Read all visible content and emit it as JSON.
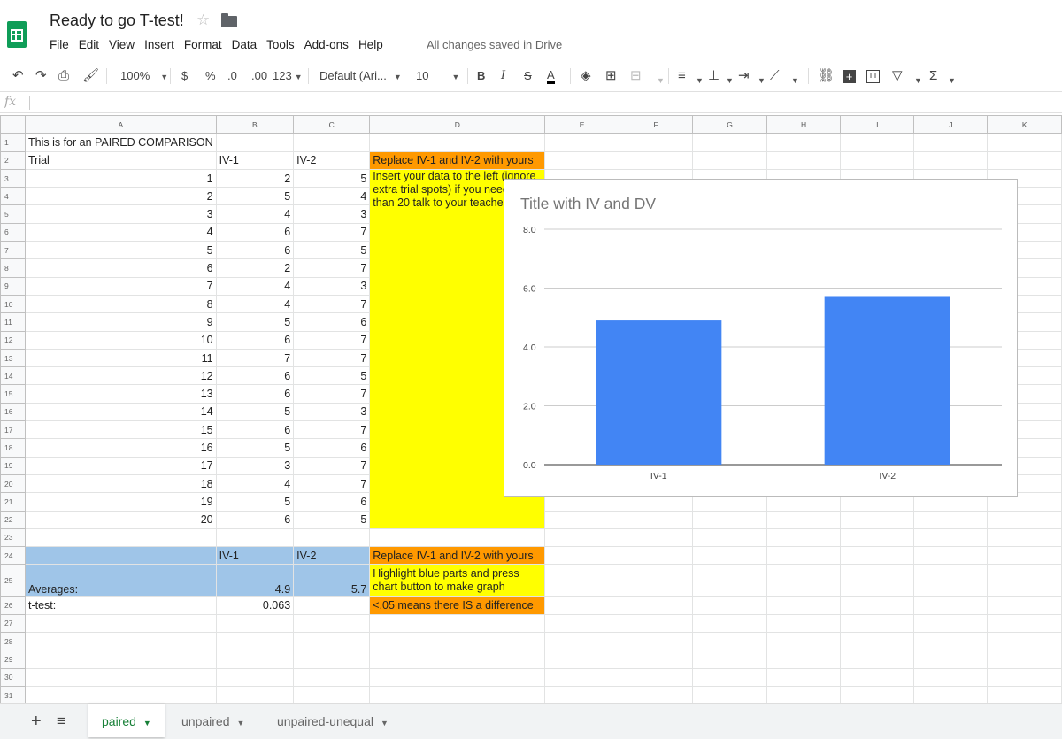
{
  "app": {
    "doc_title": "Ready to go T-test!",
    "save_status": "All changes saved in Drive",
    "menu": [
      "File",
      "Edit",
      "View",
      "Insert",
      "Format",
      "Data",
      "Tools",
      "Add-ons",
      "Help"
    ]
  },
  "toolbar": {
    "zoom": "100%",
    "currency": "$",
    "percent": "%",
    "dec_decrease": ".0",
    "dec_increase": ".00",
    "more_formats": "123",
    "font": "Default (Ari...",
    "font_size": "10",
    "bold": "B",
    "italic": "I",
    "strike": "S",
    "text_color": "A"
  },
  "formula_bar": {
    "fx": "fx",
    "value": ""
  },
  "columns": [
    "A",
    "B",
    "C",
    "D",
    "E",
    "F",
    "G",
    "H",
    "I",
    "J",
    "K"
  ],
  "rows": {
    "r1": {
      "A": "This is for an PAIRED COMPARISON"
    },
    "r2": {
      "A": "Trial",
      "B": "IV-1",
      "C": "IV-2",
      "D": "Replace IV-1 and IV-2 with yours"
    },
    "trials": [
      [
        "1",
        "2",
        "5"
      ],
      [
        "2",
        "5",
        "4"
      ],
      [
        "3",
        "4",
        "3"
      ],
      [
        "4",
        "6",
        "7"
      ],
      [
        "5",
        "6",
        "5"
      ],
      [
        "6",
        "2",
        "7"
      ],
      [
        "7",
        "4",
        "3"
      ],
      [
        "8",
        "4",
        "7"
      ],
      [
        "9",
        "5",
        "6"
      ],
      [
        "10",
        "6",
        "7"
      ],
      [
        "11",
        "7",
        "7"
      ],
      [
        "12",
        "6",
        "5"
      ],
      [
        "13",
        "6",
        "7"
      ],
      [
        "14",
        "5",
        "3"
      ],
      [
        "15",
        "6",
        "7"
      ],
      [
        "16",
        "5",
        "6"
      ],
      [
        "17",
        "3",
        "7"
      ],
      [
        "18",
        "4",
        "7"
      ],
      [
        "19",
        "5",
        "6"
      ],
      [
        "20",
        "6",
        "5"
      ]
    ],
    "note_d3": "Insert your data to the left (ignore extra trial spots) if you need more than 20 talk to your teacher :)",
    "r24": {
      "B": "IV-1",
      "C": "IV-2",
      "D": "Replace IV-1 and IV-2 with yours"
    },
    "r25": {
      "A": "Averages:",
      "B": "4.9",
      "C": "5.7",
      "D": "Highlight blue parts and press chart button to make graph"
    },
    "r26": {
      "A": "t-test:",
      "B": "0.063",
      "D": "<.05 means there IS a difference"
    }
  },
  "chart_data": {
    "type": "bar",
    "title": "Title with IV and DV",
    "categories": [
      "IV-1",
      "IV-2"
    ],
    "values": [
      4.9,
      5.7
    ],
    "ylim": [
      0,
      8
    ],
    "yticks": [
      "0.0",
      "2.0",
      "4.0",
      "6.0",
      "8.0"
    ],
    "grid": true,
    "bar_color": "#4285f4"
  },
  "sheets": [
    {
      "label": "paired",
      "active": true
    },
    {
      "label": "unpaired",
      "active": false
    },
    {
      "label": "unpaired-unequal",
      "active": false
    }
  ],
  "colors": {
    "accent_green": "#0f9d58",
    "orange": "#ff9900",
    "yellow": "#ffff00",
    "blue": "#9fc5e8"
  }
}
